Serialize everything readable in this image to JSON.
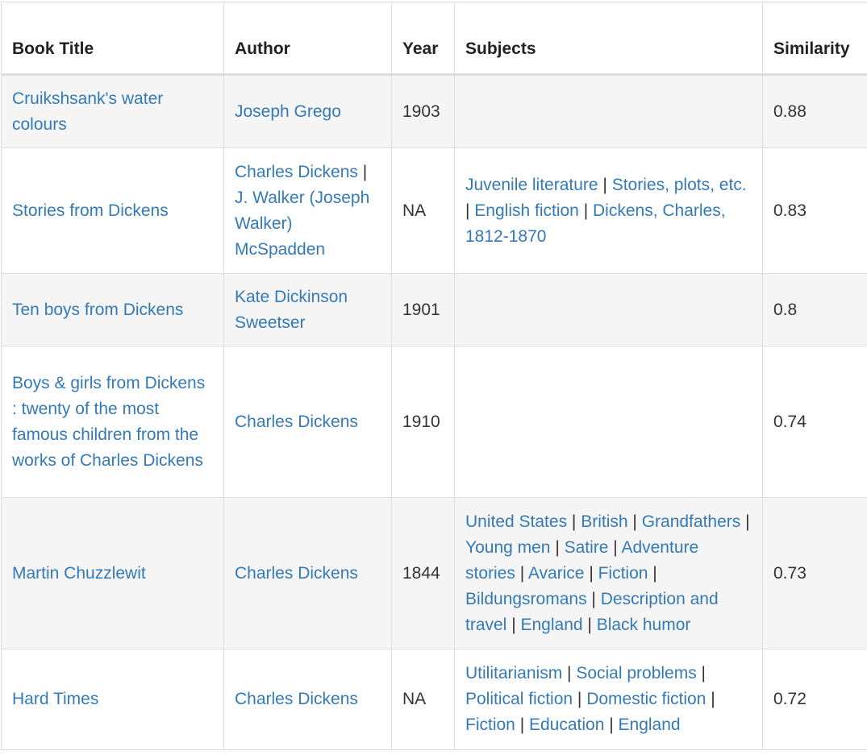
{
  "headers": {
    "title": "Book Title",
    "author": "Author",
    "year": "Year",
    "subjects": "Subjects",
    "similarity": "Similarity"
  },
  "rows": [
    {
      "title": "Cruikshsank's water colours",
      "authors": [
        "Joseph Grego"
      ],
      "year": "1903",
      "subjects": [],
      "similarity": "0.88"
    },
    {
      "title": "Stories from Dickens",
      "authors": [
        "Charles Dickens",
        "J. Walker (Joseph Walker) McSpadden"
      ],
      "year": "NA",
      "subjects": [
        "Juvenile literature",
        "Stories, plots, etc.",
        "English fiction",
        "Dickens, Charles, 1812-1870"
      ],
      "similarity": "0.83"
    },
    {
      "title": "Ten boys from Dickens",
      "authors": [
        "Kate Dickinson Sweetser"
      ],
      "year": "1901",
      "subjects": [],
      "similarity": "0.8"
    },
    {
      "title": "Boys & girls from Dickens : twenty of the most famous children from the works of Charles Dickens",
      "authors": [
        "Charles Dickens"
      ],
      "year": "1910",
      "subjects": [],
      "similarity": "0.74"
    },
    {
      "title": "Martin Chuzzlewit",
      "authors": [
        "Charles Dickens"
      ],
      "year": "1844",
      "subjects": [
        "United States",
        "British",
        "Grandfathers",
        "Young men",
        "Satire",
        "Adventure stories",
        "Avarice",
        "Fiction",
        "Bildungsromans",
        "Description and travel",
        "England",
        "Black humor"
      ],
      "similarity": "0.73"
    },
    {
      "title": "Hard Times",
      "authors": [
        "Charles Dickens"
      ],
      "year": "NA",
      "subjects": [
        "Utilitarianism",
        "Social problems",
        "Political fiction",
        "Domestic fiction",
        "Fiction",
        "Education",
        "England"
      ],
      "similarity": "0.72"
    }
  ],
  "separator": " | ",
  "colors": {
    "link": "#337ab7",
    "text": "#333333",
    "stripe": "#f5f5f5",
    "border": "#dddddd"
  }
}
